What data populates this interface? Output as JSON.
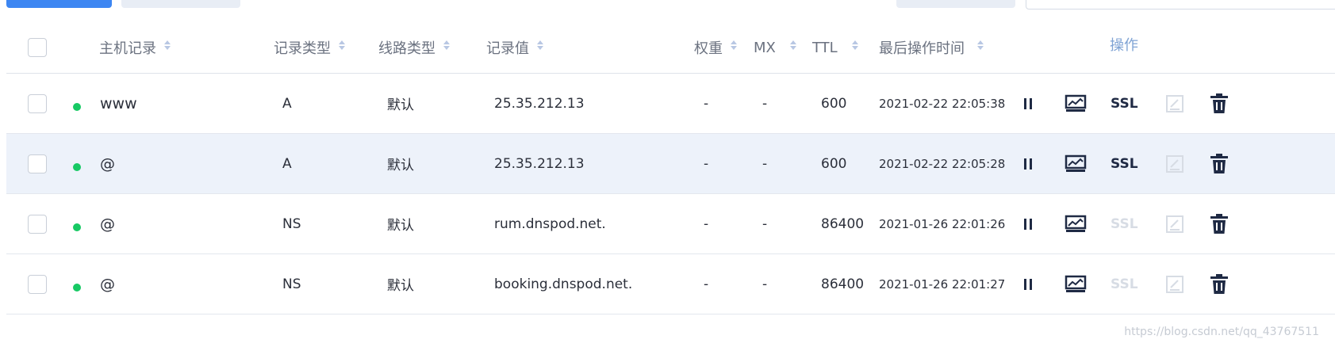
{
  "header": {
    "columns": {
      "host": "主机记录",
      "type": "记录类型",
      "line": "线路类型",
      "value": "记录值",
      "weight": "权重",
      "mx": "MX",
      "ttl": "TTL",
      "last_time": "最后操作时间",
      "ops": "操作"
    }
  },
  "rows": [
    {
      "host": "www",
      "type": "A",
      "line": "默认",
      "value": "25.35.212.13",
      "weight": "-",
      "mx": "-",
      "ttl": "600",
      "last_time": "2021-02-22 22:05:38",
      "ssl": "SSL",
      "ssl_enabled": true
    },
    {
      "host": "@",
      "type": "A",
      "line": "默认",
      "value": "25.35.212.13",
      "weight": "-",
      "mx": "-",
      "ttl": "600",
      "last_time": "2021-02-22 22:05:28",
      "ssl": "SSL",
      "ssl_enabled": true
    },
    {
      "host": "@",
      "type": "NS",
      "line": "默认",
      "value": "rum.dnspod.net.",
      "weight": "-",
      "mx": "-",
      "ttl": "86400",
      "last_time": "2021-01-26 22:01:26",
      "ssl": "SSL",
      "ssl_enabled": false
    },
    {
      "host": "@",
      "type": "NS",
      "line": "默认",
      "value": "booking.dnspod.net.",
      "weight": "-",
      "mx": "-",
      "ttl": "86400",
      "last_time": "2021-01-26 22:01:27",
      "ssl": "SSL",
      "ssl_enabled": false
    }
  ],
  "watermark": "https://blog.csdn.net/qq_43767511",
  "icons": {
    "pause": "pause-icon",
    "monitor": "monitor-icon",
    "edit_note": "note-edit-icon",
    "delete": "trash-icon"
  },
  "colors": {
    "primary": "#3d86f2",
    "status_dot": "#17c964",
    "hover_row": "#edf2fa",
    "ops_header": "#7fa3d4",
    "disabled": "#d7dce4"
  }
}
